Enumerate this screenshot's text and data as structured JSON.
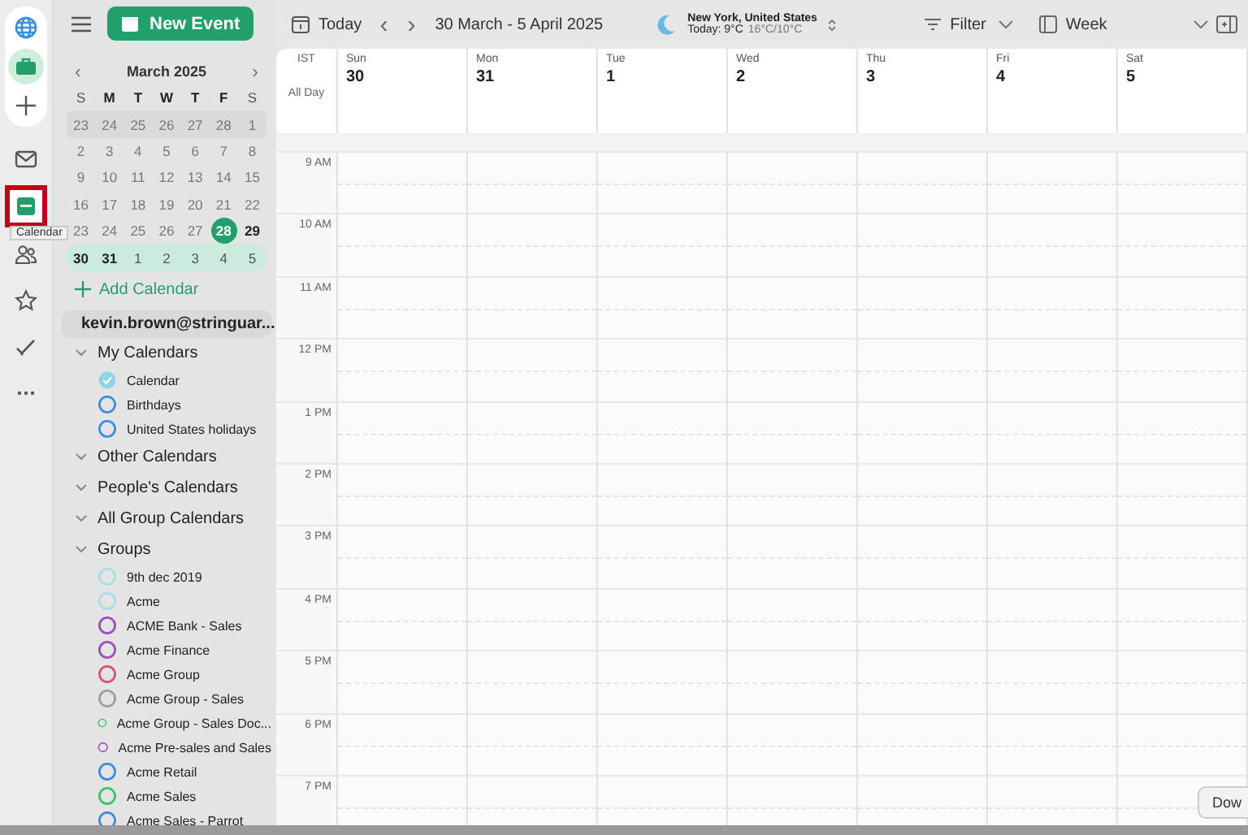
{
  "rail": {
    "top_items": [
      {
        "selected": false
      },
      {
        "selected": true
      },
      {
        "selected": false
      }
    ],
    "items": [
      {
        "selected": false,
        "annotated": false
      },
      {
        "selected": true,
        "annotated": true,
        "tooltip": "Calendar"
      },
      {
        "selected": false,
        "annotated": false
      },
      {
        "selected": false,
        "annotated": false
      },
      {
        "selected": false,
        "annotated": false
      },
      {
        "selected": false,
        "annotated": false
      }
    ]
  },
  "new_event": "New Event",
  "mini_calendar": {
    "title": "March 2025",
    "prev": "‹",
    "next": "›",
    "weekdays": [
      {
        "label": "S",
        "bold": false
      },
      {
        "label": "M",
        "bold": true
      },
      {
        "label": "T",
        "bold": true
      },
      {
        "label": "W",
        "bold": true
      },
      {
        "label": "T",
        "bold": true
      },
      {
        "label": "F",
        "bold": true
      },
      {
        "label": "S",
        "bold": false
      }
    ],
    "weeks": [
      {
        "hovered": true,
        "current": false,
        "days": [
          {
            "label": "23",
            "muted": true,
            "today": false,
            "bold": false
          },
          {
            "label": "24",
            "muted": true,
            "today": false,
            "bold": false
          },
          {
            "label": "25",
            "muted": true,
            "today": false,
            "bold": false
          },
          {
            "label": "26",
            "muted": true,
            "today": false,
            "bold": false
          },
          {
            "label": "27",
            "muted": true,
            "today": false,
            "bold": false
          },
          {
            "label": "28",
            "muted": true,
            "today": false,
            "bold": false
          },
          {
            "label": "1",
            "muted": true,
            "today": false,
            "bold": false
          }
        ]
      },
      {
        "hovered": false,
        "current": false,
        "days": [
          {
            "label": "2",
            "muted": true,
            "today": false,
            "bold": false
          },
          {
            "label": "3",
            "muted": true,
            "today": false,
            "bold": false
          },
          {
            "label": "4",
            "muted": true,
            "today": false,
            "bold": false
          },
          {
            "label": "5",
            "muted": true,
            "today": false,
            "bold": false
          },
          {
            "label": "6",
            "muted": true,
            "today": false,
            "bold": false
          },
          {
            "label": "7",
            "muted": true,
            "today": false,
            "bold": false
          },
          {
            "label": "8",
            "muted": true,
            "today": false,
            "bold": false
          }
        ]
      },
      {
        "hovered": false,
        "current": false,
        "days": [
          {
            "label": "9",
            "muted": true,
            "today": false,
            "bold": false
          },
          {
            "label": "10",
            "muted": true,
            "today": false,
            "bold": false
          },
          {
            "label": "11",
            "muted": true,
            "today": false,
            "bold": false
          },
          {
            "label": "12",
            "muted": true,
            "today": false,
            "bold": false
          },
          {
            "label": "13",
            "muted": true,
            "today": false,
            "bold": false
          },
          {
            "label": "14",
            "muted": true,
            "today": false,
            "bold": false
          },
          {
            "label": "15",
            "muted": true,
            "today": false,
            "bold": false
          }
        ]
      },
      {
        "hovered": false,
        "current": false,
        "days": [
          {
            "label": "16",
            "muted": true,
            "today": false,
            "bold": false
          },
          {
            "label": "17",
            "muted": true,
            "today": false,
            "bold": false
          },
          {
            "label": "18",
            "muted": true,
            "today": false,
            "bold": false
          },
          {
            "label": "19",
            "muted": true,
            "today": false,
            "bold": false
          },
          {
            "label": "20",
            "muted": true,
            "today": false,
            "bold": false
          },
          {
            "label": "21",
            "muted": true,
            "today": false,
            "bold": false
          },
          {
            "label": "22",
            "muted": true,
            "today": false,
            "bold": false
          }
        ]
      },
      {
        "hovered": false,
        "current": false,
        "days": [
          {
            "label": "23",
            "muted": true,
            "today": false,
            "bold": false
          },
          {
            "label": "24",
            "muted": true,
            "today": false,
            "bold": false
          },
          {
            "label": "25",
            "muted": true,
            "today": false,
            "bold": false
          },
          {
            "label": "26",
            "muted": true,
            "today": false,
            "bold": false
          },
          {
            "label": "27",
            "muted": true,
            "today": false,
            "bold": false
          },
          {
            "label": "28",
            "muted": false,
            "today": true,
            "bold": true
          },
          {
            "label": "29",
            "muted": false,
            "today": false,
            "bold": true
          }
        ]
      },
      {
        "hovered": false,
        "current": true,
        "days": [
          {
            "label": "30",
            "muted": false,
            "today": false,
            "bold": true
          },
          {
            "label": "31",
            "muted": false,
            "today": false,
            "bold": true
          },
          {
            "label": "1",
            "muted": false,
            "today": false,
            "bold": false
          },
          {
            "label": "2",
            "muted": false,
            "today": false,
            "bold": false
          },
          {
            "label": "3",
            "muted": false,
            "today": false,
            "bold": false
          },
          {
            "label": "4",
            "muted": false,
            "today": false,
            "bold": false
          },
          {
            "label": "5",
            "muted": false,
            "today": false,
            "bold": false
          }
        ]
      }
    ]
  },
  "add_calendar": "Add Calendar",
  "account": {
    "label": "kevin.brown@stringuar...",
    "sections": [
      {
        "label": "My Calendars",
        "children": [
          {
            "label": "Calendar",
            "checked": true,
            "color": "#8fd3e6"
          },
          {
            "label": "Birthdays",
            "checked": false,
            "color": "#3b8de0"
          },
          {
            "label": "United States holidays",
            "checked": false,
            "color": "#3b8de0"
          }
        ]
      },
      {
        "label": "Other Calendars"
      },
      {
        "label": "People's Calendars"
      },
      {
        "label": "All Group Calendars"
      },
      {
        "label": "Groups",
        "children": [
          {
            "label": "9th dec 2019",
            "checked": false,
            "color": "#a8dde8"
          },
          {
            "label": "Acme",
            "checked": false,
            "color": "#a8dde8"
          },
          {
            "label": "ACME Bank - Sales",
            "checked": false,
            "color": "#9b4fc0"
          },
          {
            "label": "Acme Finance",
            "checked": false,
            "color": "#9b4fc0"
          },
          {
            "label": "Acme Group",
            "checked": false,
            "color": "#e0507a"
          },
          {
            "label": "Acme Group - Sales",
            "checked": false,
            "color": "#a0a0a0"
          },
          {
            "label": "Acme Group - Sales Doc...",
            "checked": false,
            "color": "#3cc46a"
          },
          {
            "label": "Acme Pre-sales and Sales",
            "checked": false,
            "color": "#9b4fc0"
          },
          {
            "label": "Acme Retail",
            "checked": false,
            "color": "#3b8de0"
          },
          {
            "label": "Acme Sales",
            "checked": false,
            "color": "#3cc46a"
          },
          {
            "label": "Acme Sales - Parrot",
            "checked": false,
            "color": "#3b8de0"
          }
        ]
      }
    ]
  },
  "toolbar": {
    "today": "Today",
    "prev": "‹",
    "next": "›",
    "range": "30 March - 5 April 2025",
    "weather": {
      "location": "New York, United States",
      "today": "Today: 9°C",
      "range": "16°C/10°C"
    },
    "filter": "Filter",
    "view": "Week"
  },
  "grid": {
    "timezone": "IST",
    "all_day": "All Day",
    "days": [
      {
        "weekday": "Sun",
        "date": "30"
      },
      {
        "weekday": "Mon",
        "date": "31"
      },
      {
        "weekday": "Tue",
        "date": "1"
      },
      {
        "weekday": "Wed",
        "date": "2"
      },
      {
        "weekday": "Thu",
        "date": "3"
      },
      {
        "weekday": "Fri",
        "date": "4"
      },
      {
        "weekday": "Sat",
        "date": "5"
      }
    ],
    "hours": [
      "9 AM",
      "10 AM",
      "11 AM",
      "12 PM",
      "1 PM",
      "2 PM",
      "3 PM",
      "4 PM",
      "5 PM",
      "6 PM",
      "7 PM"
    ]
  },
  "corner_button": "Dow"
}
